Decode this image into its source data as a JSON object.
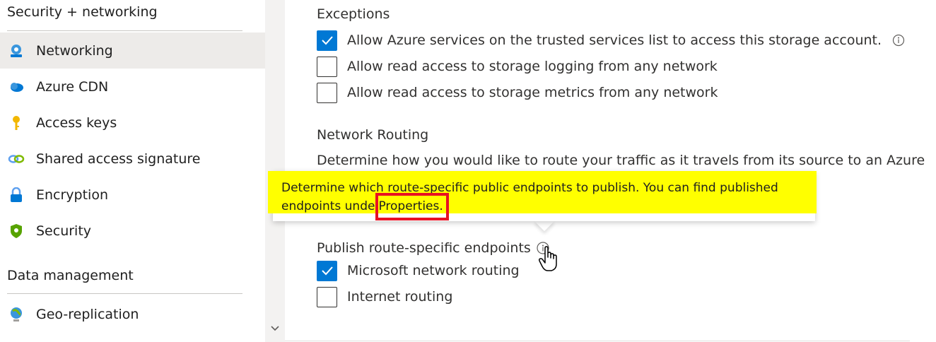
{
  "sidebar": {
    "section1": "Security + networking",
    "section2": "Data management",
    "items": [
      {
        "label": "Networking",
        "icon": "networking-icon",
        "selected": true
      },
      {
        "label": "Azure CDN",
        "icon": "cloud-icon"
      },
      {
        "label": "Access keys",
        "icon": "key-icon"
      },
      {
        "label": "Shared access signature",
        "icon": "link-icon"
      },
      {
        "label": "Encryption",
        "icon": "lock-icon"
      },
      {
        "label": "Security",
        "icon": "shield-icon"
      },
      {
        "label": "Geo-replication",
        "icon": "globe-icon"
      }
    ]
  },
  "main": {
    "exceptions_heading": "Exceptions",
    "exceptions": [
      {
        "label": "Allow Azure services on the trusted services list to access this storage account.",
        "checked": true
      },
      {
        "label": "Allow read access to storage logging from any network",
        "checked": false
      },
      {
        "label": "Allow read access to storage metrics from any network",
        "checked": false
      }
    ],
    "routing_heading": "Network Routing",
    "routing_desc": "Determine how you would like to route your traffic as it travels from its source to an Azure",
    "publish_heading": "Publish route-specific endpoints",
    "publish": [
      {
        "label": "Microsoft network routing",
        "checked": true
      },
      {
        "label": "Internet routing",
        "checked": false
      }
    ]
  },
  "tooltip": {
    "line1": "Determine which route-specific public endpoints to publish. You can find published",
    "line2_prefix": "endpoints unde",
    "line2_link": "Properties.",
    "highlight_color": "#ffff00",
    "box_color": "#e81123"
  },
  "colors": {
    "accent": "#0078d4",
    "selected_bg": "#edebe9"
  }
}
